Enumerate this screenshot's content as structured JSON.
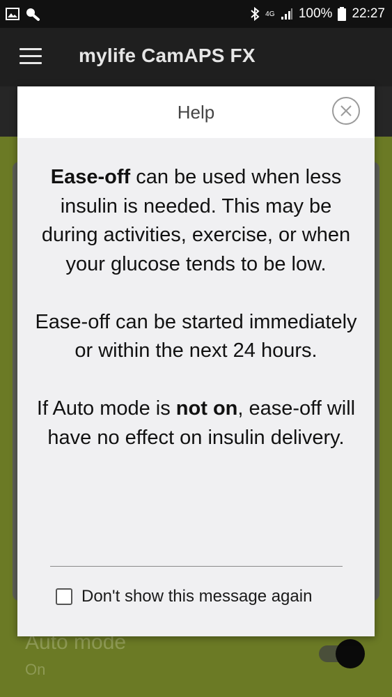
{
  "status_bar": {
    "network": "4G",
    "battery": "100%",
    "time": "22:27"
  },
  "app_bar": {
    "title": "mylife CamAPS FX"
  },
  "background": {
    "auto_mode_label": "Auto mode",
    "auto_mode_status": "On"
  },
  "dialog": {
    "title": "Help",
    "para1_bold": "Ease-off",
    "para1_rest": " can be used when less insulin is needed. This may be during activities, exercise, or when your glucose tends to be low.",
    "para2": "Ease-off can be started immediately or within the next 24 hours.",
    "para3_a": "If Auto mode is ",
    "para3_bold": "not on",
    "para3_b": ", ease-off will have no effect on insulin delivery.",
    "checkbox_label": "Don't show this message again"
  },
  "colors": {
    "background_green": "#6b7a25",
    "dialog_bg": "#f0f0f2"
  }
}
